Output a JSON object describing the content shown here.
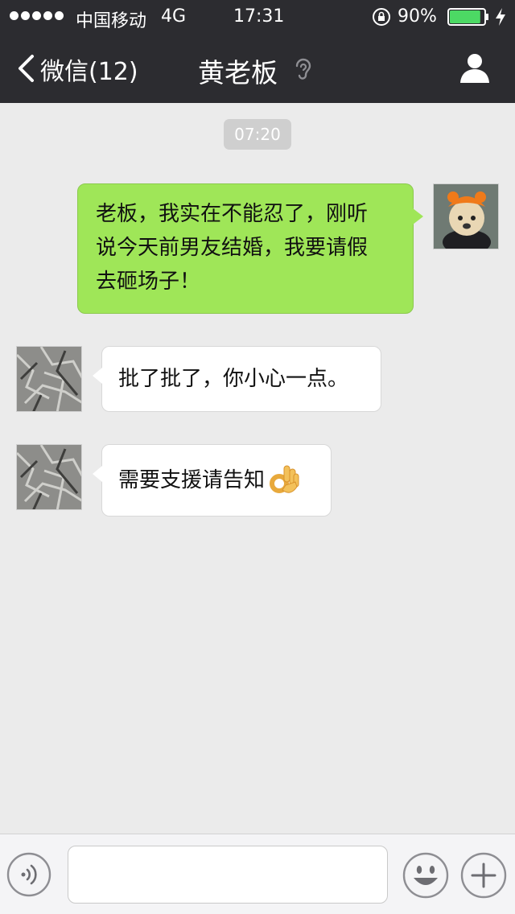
{
  "status_bar": {
    "carrier": "中国移动",
    "network": "4G",
    "time": "17:31",
    "battery": "90%",
    "battery_level": 0.9
  },
  "nav": {
    "back_label": "微信(12)",
    "title": "黄老板",
    "icons": [
      "back-chevron-icon",
      "ear-icon",
      "profile-icon"
    ]
  },
  "chat": {
    "timestamp": "07:20",
    "messages": [
      {
        "from": "me",
        "lines": [
          "老板，我实在不能忍了，刚听",
          "说今天前男友结婚，我要请假",
          "去砸场子！"
        ]
      },
      {
        "from": "boss",
        "text": "批了批了，你小心一点。"
      },
      {
        "from": "boss",
        "text": "需要支援请告知",
        "emoji": "ok-hand-icon"
      }
    ]
  },
  "input_bar": {
    "icons": [
      "voice-icon",
      "emoji-icon",
      "plus-icon"
    ],
    "text_value": ""
  },
  "colors": {
    "header_bg": "#2c2c30",
    "chat_bg": "#ebebeb",
    "sent_bubble": "#9fe658",
    "received_bubble": "#ffffff"
  }
}
